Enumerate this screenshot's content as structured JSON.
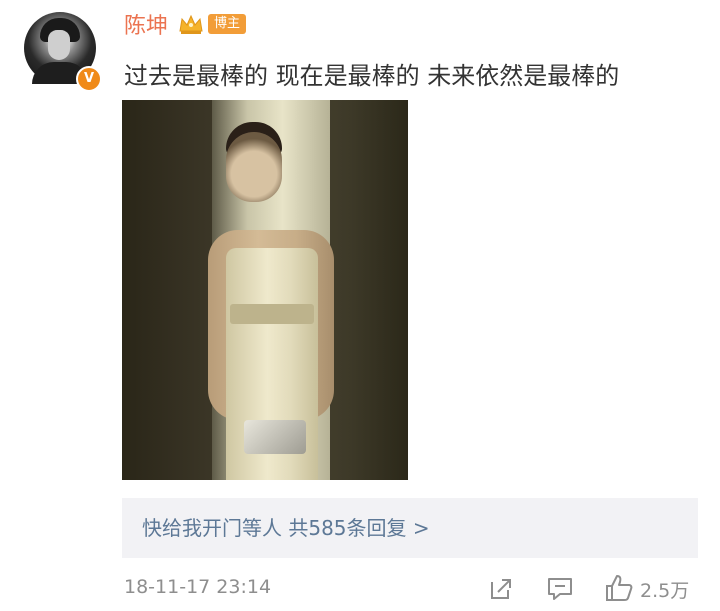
{
  "post": {
    "author": "陈坤",
    "blogger_badge": "博主",
    "verified_mark": "V",
    "text": "过去是最棒的 现在是最棒的 未来依然是最棒的"
  },
  "replies": {
    "text": "快给我开门等人 共585条回复 >"
  },
  "footer": {
    "timestamp": "18-11-17 23:14",
    "like_count": "2.5万"
  },
  "colors": {
    "username": "#eb7350",
    "badge": "#f29d38",
    "reply_link": "#5d7896",
    "meta": "#8e8e8e"
  },
  "icons": [
    "crown-icon",
    "share-icon",
    "comment-icon",
    "like-icon"
  ]
}
